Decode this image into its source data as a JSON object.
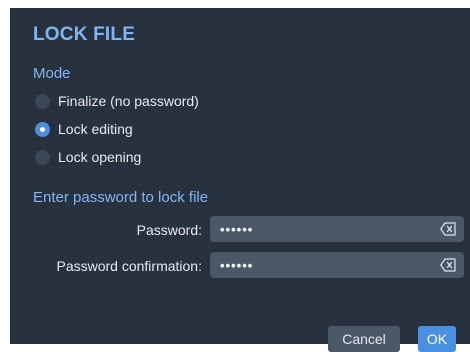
{
  "dialog": {
    "title": "LOCK FILE",
    "mode": {
      "label": "Mode",
      "options": [
        {
          "label": "Finalize (no password)",
          "selected": false
        },
        {
          "label": "Lock editing",
          "selected": true
        },
        {
          "label": "Lock opening",
          "selected": false
        }
      ]
    },
    "password_section": {
      "label": "Enter password to lock file",
      "password_label": "Password:",
      "password_value": "••••••",
      "confirmation_label": "Password confirmation:",
      "confirmation_value": "••••••",
      "clear_icon": "backspace-clear-icon"
    },
    "buttons": {
      "cancel": "Cancel",
      "ok": "OK"
    }
  },
  "colors": {
    "background": "#28323f",
    "accent": "#7fb6f2",
    "primary_button": "#4a90e2",
    "input_background": "#4b5868"
  }
}
